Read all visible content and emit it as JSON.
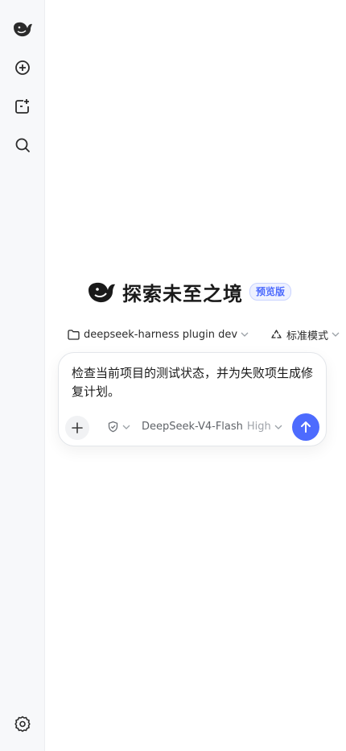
{
  "sidebar": {
    "icons": [
      "deepseek-logo-icon",
      "new-chat-icon",
      "new-project-icon",
      "search-icon",
      "settings-icon"
    ]
  },
  "hero": {
    "title": "探索未至之境",
    "badge": "预览版"
  },
  "context": {
    "folder": "deepseek-harness plugin dev",
    "mode": "标准模式"
  },
  "composer": {
    "text": "检查当前项目的测试状态，并为失败项生成修复计划。",
    "model_name": "DeepSeek-V4-Flash",
    "model_level": "High"
  },
  "colors": {
    "accent": "#4d6bfe",
    "sidebar_bg": "#f7f8fa"
  }
}
